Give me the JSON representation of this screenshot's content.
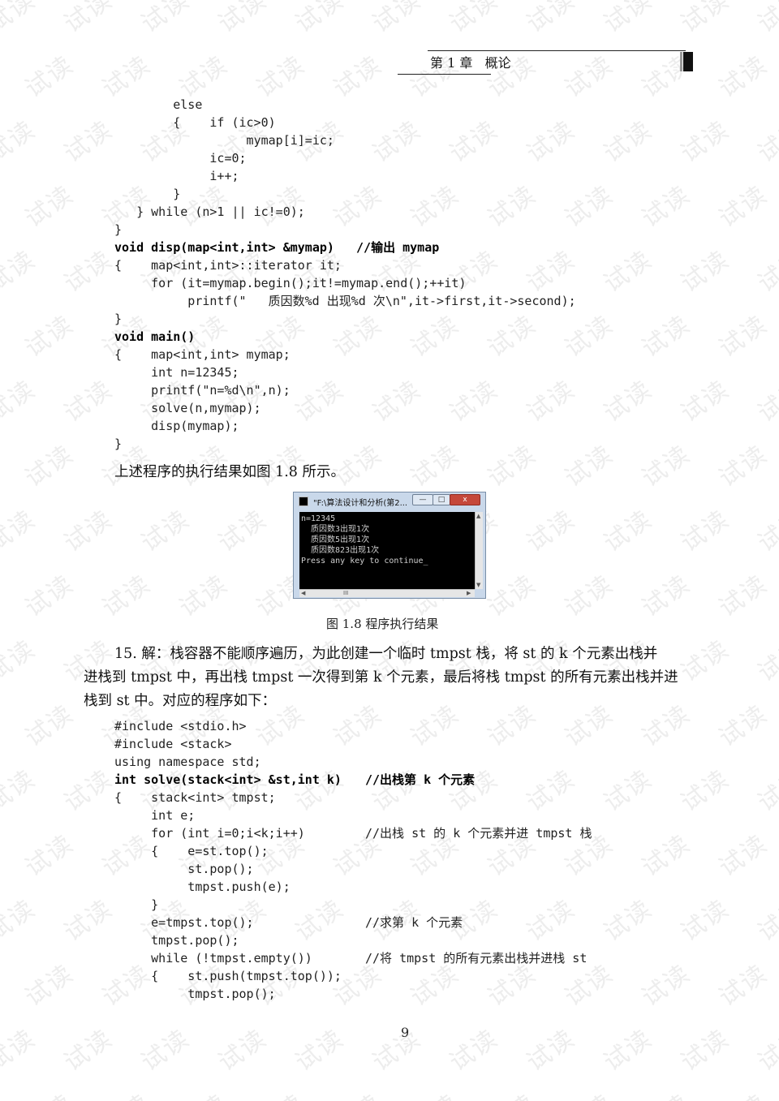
{
  "watermark": "试读",
  "header": {
    "chapter": "第 1 章",
    "title": "概论"
  },
  "code1": [
    {
      "t": "        else",
      "b": false
    },
    {
      "t": "        {    if (ic>0)",
      "b": false
    },
    {
      "t": "                  mymap[i]=ic;",
      "b": false
    },
    {
      "t": "             ic=0;",
      "b": false
    },
    {
      "t": "             i++;",
      "b": false
    },
    {
      "t": "        }",
      "b": false
    },
    {
      "t": "   } while (n>1 || ic!=0);",
      "b": false
    },
    {
      "t": "}",
      "b": false
    },
    {
      "t": "void disp(map<int,int> &mymap)   //输出 mymap",
      "b": true
    },
    {
      "t": "{    map<int,int>::iterator it;",
      "b": false
    },
    {
      "t": "     for (it=mymap.begin();it!=mymap.end();++it)",
      "b": false
    },
    {
      "t": "          printf(\"   质因数%d 出现%d 次\\n\",it->first,it->second);",
      "b": false
    },
    {
      "t": "}",
      "b": false
    },
    {
      "t": "void main()",
      "b": true
    },
    {
      "t": "{    map<int,int> mymap;",
      "b": false
    },
    {
      "t": "     int n=12345;",
      "b": false
    },
    {
      "t": "     printf(\"n=%d\\n\",n);",
      "b": false
    },
    {
      "t": "     solve(n,mymap);",
      "b": false
    },
    {
      "t": "     disp(mymap);",
      "b": false
    },
    {
      "t": "}",
      "b": false
    }
  ],
  "result_text": "上述程序的执行结果如图 1.8 所示。",
  "console": {
    "title": "\"F:\\算法设计和分析(第2...",
    "min": "—",
    "max": "□",
    "close": "x",
    "lines": [
      "n=12345",
      "  质因数3出现1次",
      "  质因数5出现1次",
      "  质因数823出现1次",
      "Press any key to continue_"
    ],
    "hscroll_thumb": "III"
  },
  "figure_caption": "图 1.8    程序执行结果",
  "para15": {
    "line1": "15.    解：栈容器不能顺序遍历，为此创建一个临时 tmpst 栈，将 st 的 k 个元素出栈并",
    "line2": "进栈到 tmpst 中，再出栈 tmpst 一次得到第 k 个元素，最后将栈 tmpst 的所有元素出栈并进",
    "line3": "栈到 st 中。对应的程序如下："
  },
  "code2": [
    {
      "t": "#include <stdio.h>",
      "b": false,
      "c": ""
    },
    {
      "t": "#include <stack>",
      "b": false,
      "c": ""
    },
    {
      "t": "using namespace std;",
      "b": false,
      "c": ""
    },
    {
      "t": "int solve(stack<int> &st,int k)",
      "b": true,
      "c": "//出栈第 k 个元素"
    },
    {
      "t": "{    stack<int> tmpst;",
      "b": false,
      "c": ""
    },
    {
      "t": "     int e;",
      "b": false,
      "c": ""
    },
    {
      "t": "     for (int i=0;i<k;i++)",
      "b": false,
      "c": "//出栈 st 的 k 个元素并进 tmpst 栈"
    },
    {
      "t": "     {    e=st.top();",
      "b": false,
      "c": ""
    },
    {
      "t": "          st.pop();",
      "b": false,
      "c": ""
    },
    {
      "t": "          tmpst.push(e);",
      "b": false,
      "c": ""
    },
    {
      "t": "     }",
      "b": false,
      "c": ""
    },
    {
      "t": "     e=tmpst.top();",
      "b": false,
      "c": "//求第 k 个元素"
    },
    {
      "t": "     tmpst.pop();",
      "b": false,
      "c": ""
    },
    {
      "t": "     while (!tmpst.empty())",
      "b": false,
      "c": "//将 tmpst 的所有元素出栈并进栈 st"
    },
    {
      "t": "     {    st.push(tmpst.top());",
      "b": false,
      "c": ""
    },
    {
      "t": "          tmpst.pop();",
      "b": false,
      "c": ""
    }
  ],
  "page_number": "9"
}
